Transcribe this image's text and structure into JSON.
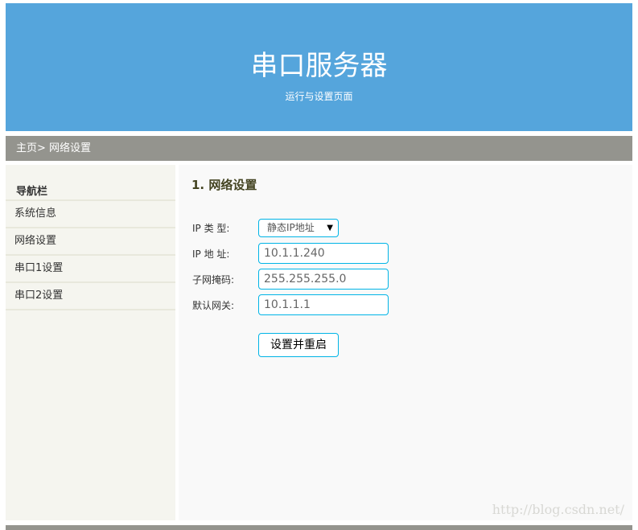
{
  "header": {
    "title": "串口服务器",
    "subtitle": "运行与设置页面"
  },
  "breadcrumb": "主页> 网络设置",
  "sidebar": {
    "title": "导航栏",
    "items": [
      {
        "label": "系统信息"
      },
      {
        "label": "网络设置"
      },
      {
        "label": "串口1设置"
      },
      {
        "label": "串口2设置"
      }
    ]
  },
  "main": {
    "heading": "1. 网络设置",
    "fields": [
      {
        "label": "IP 类 型:",
        "value": "静态IP地址"
      },
      {
        "label": "IP 地 址:",
        "value": "10.1.1.240"
      },
      {
        "label": "子网掩码:",
        "value": "255.255.255.0"
      },
      {
        "label": "默认网关:",
        "value": "10.1.1.1"
      }
    ],
    "submit_label": "设置并重启"
  },
  "watermark": "http://blog.csdn.net/",
  "colors": {
    "header": "#55a5dc",
    "bar": "#94948e",
    "accent": "#00b4e6"
  }
}
